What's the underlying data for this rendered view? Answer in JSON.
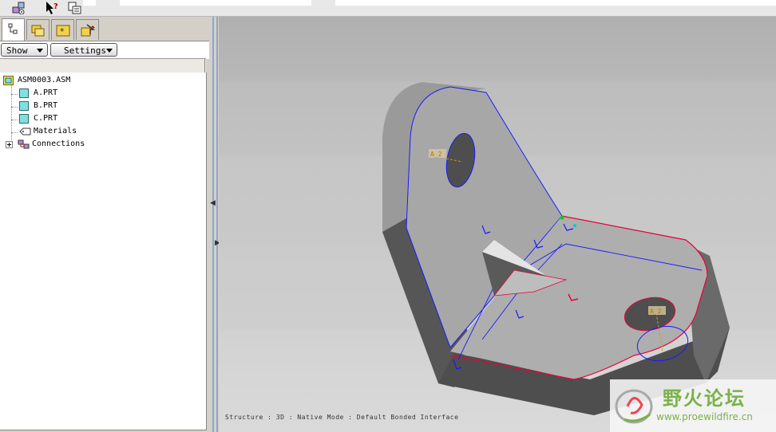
{
  "tree_panel": {
    "show_label": "Show",
    "settings_label": "Settings",
    "items": [
      {
        "label": "ASM0003.ASM"
      },
      {
        "label": "A.PRT"
      },
      {
        "label": "B.PRT"
      },
      {
        "label": "C.PRT"
      },
      {
        "label": "Materials"
      },
      {
        "label": "Connections"
      }
    ]
  },
  "viewport": {
    "status_text": "Structure : 3D : Native Mode : Default Bonded Interface",
    "axis_label_1": "A_2",
    "axis_label_2": "A_2"
  },
  "watermark": {
    "title": "野火论坛",
    "url": "www.proewildfire.cn"
  },
  "colors": {
    "edge_blue": "#1a1aff",
    "edge_red": "#e8003c",
    "part_gray": "#a9a9a9",
    "watermark_green": "#7ab24a"
  }
}
